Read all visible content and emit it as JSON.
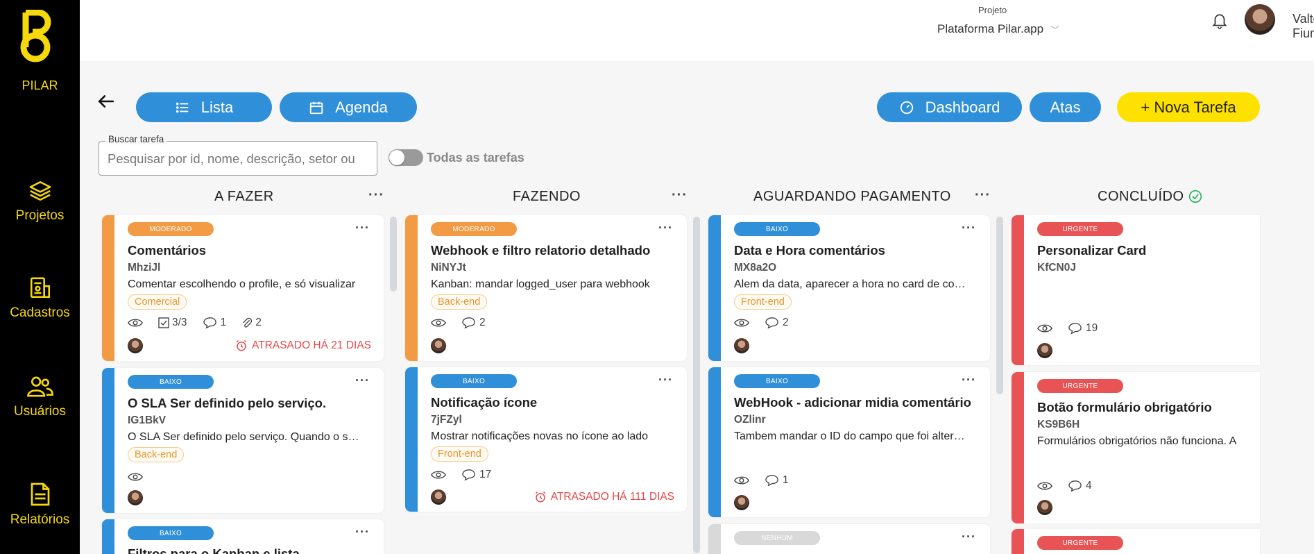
{
  "app": {
    "logo_text": "PILAR"
  },
  "sidebar": {
    "items": [
      {
        "label": "Projetos",
        "icon": "layers-icon"
      },
      {
        "label": "Cadastros",
        "icon": "id-card-icon"
      },
      {
        "label": "Usuários",
        "icon": "users-icon"
      },
      {
        "label": "Relatórios",
        "icon": "document-icon"
      }
    ]
  },
  "header": {
    "project_label": "Projeto",
    "project_value": "Plataforma Pilar.app",
    "user_name": "Valter Fiumi"
  },
  "toolbar": {
    "lista": "Lista",
    "agenda": "Agenda",
    "dashboard": "Dashboard",
    "atas": "Atas",
    "nova_tarefa": "+ Nova Tarefa"
  },
  "search": {
    "legend": "Buscar tarefa",
    "placeholder": "Pesquisar por id, nome, descrição, setor ou",
    "toggle_label": "Todas as tarefas"
  },
  "columns": [
    {
      "title": "A FAZER",
      "cards": [
        {
          "badge": "MODERADO",
          "title": "Comentários",
          "id": "MhziJl",
          "desc": "Comentar escolhendo o profile, e só visualizar",
          "tag": "Comercial",
          "checklist": "3/3",
          "comments": "1",
          "attachments": "2",
          "late": "ATRASADO HÁ 21 DIAS"
        },
        {
          "badge": "BAIXO",
          "title": "O SLA Ser definido pelo serviço.",
          "id": "IG1BkV",
          "desc": "O SLA Ser definido pelo serviço. Quando o serviço",
          "tag": "Back-end"
        },
        {
          "badge": "BAIXO",
          "title": "Filtros para o Kanban e lista"
        }
      ]
    },
    {
      "title": "FAZENDO",
      "cards": [
        {
          "badge": "MODERADO",
          "title": "Webhook e filtro relatorio detalhado",
          "id": "NiNYJt",
          "desc": "Kanban: mandar logged_user para webhook",
          "tag": "Back-end",
          "comments": "2"
        },
        {
          "badge": "BAIXO",
          "title": "Notificação ícone",
          "id": "7jFZyl",
          "desc": "Mostrar notificações novas no ícone ao lado",
          "tag": "Front-end",
          "comments": "17",
          "late": "ATRASADO HÁ 111 DIAS"
        }
      ]
    },
    {
      "title": "AGUARDANDO PAGAMENTO",
      "cards": [
        {
          "badge": "BAIXO",
          "title": "Data e Hora comentários",
          "id": "MX8a2O",
          "desc": "Alem da data, aparecer a hora no card de comentários",
          "tag": "Front-end",
          "comments": "2"
        },
        {
          "badge": "BAIXO",
          "title": "WebHook - adicionar midia comentário",
          "id": "OZlinr",
          "desc": "Tambem mandar o ID do campo que foi alterado",
          "comments": "1"
        },
        {
          "badge": "NENHUM"
        }
      ]
    },
    {
      "title": "CONCLUÍDO",
      "cards": [
        {
          "badge": "URGENTE",
          "title": "Personalizar Card",
          "id": "KfCN0J",
          "comments": "19"
        },
        {
          "badge": "URGENTE",
          "title": "Botão formulário obrigatório",
          "id": "KS9B6H",
          "desc": "Formulários obrigatórios não funciona. A",
          "comments": "4"
        },
        {
          "badge": "URGENTE"
        }
      ]
    }
  ],
  "colors": {
    "moderado": "#f39a45",
    "baixo": "#2f8fd8",
    "urgente": "#e85456",
    "nenhum": "#d9d9d9",
    "accent_yellow": "#ffe100",
    "late_red": "#e8474a"
  }
}
